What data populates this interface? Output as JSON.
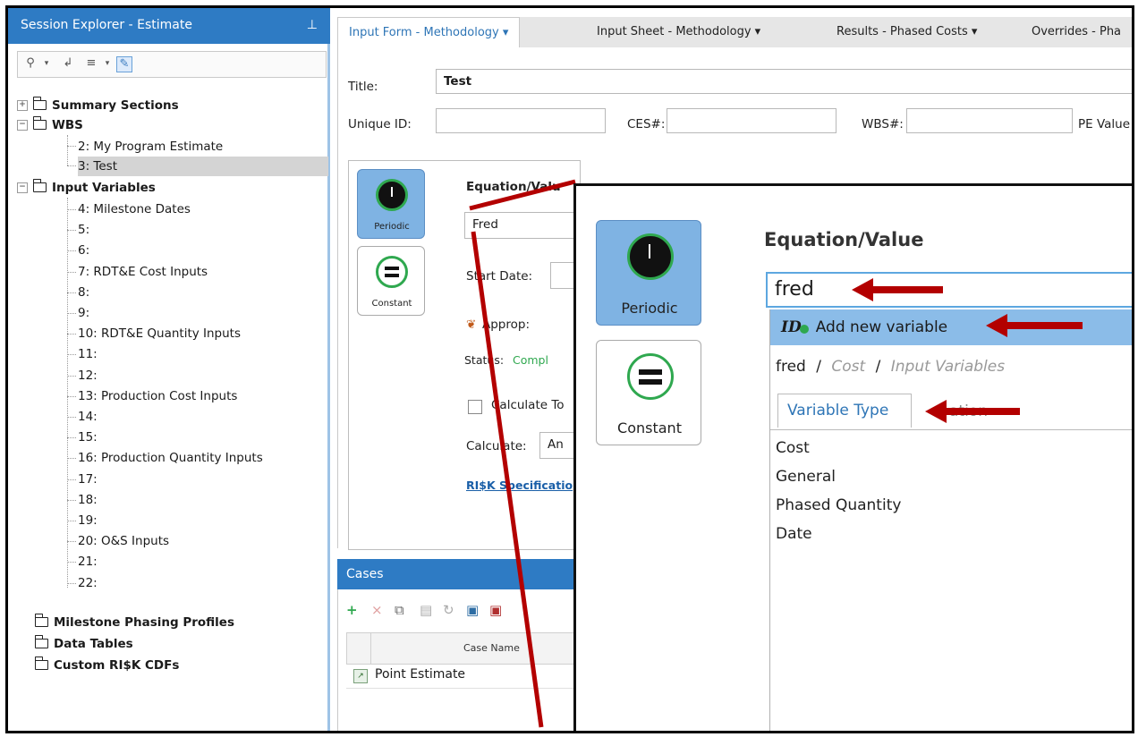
{
  "session_explorer": {
    "title": "Session Explorer - Estimate",
    "pin_icon": "pin-icon"
  },
  "tree": {
    "summary_sections": "Summary Sections",
    "wbs": "WBS",
    "wbs_children": [
      "2: My Program Estimate",
      "3: Test"
    ],
    "input_variables": "Input Variables",
    "input_children": [
      "4: Milestone Dates",
      "5:",
      "6:",
      "7: RDT&E Cost Inputs",
      "8:",
      "9:",
      "10: RDT&E Quantity Inputs",
      "11:",
      "12:",
      "13: Production Cost Inputs",
      "14:",
      "15:",
      "16: Production Quantity Inputs",
      "17:",
      "18:",
      "19:",
      "20: O&S Inputs",
      "21:",
      "22:"
    ],
    "milestone_profiles": "Milestone Phasing Profiles",
    "data_tables": "Data Tables",
    "custom_cdfs": "Custom RI$K CDFs"
  },
  "tabs": [
    "Input Form - Methodology ▾",
    "Input Sheet - Methodology ▾",
    "Results - Phased Costs ▾",
    "Overrides - Pha"
  ],
  "form": {
    "title_label": "Title:",
    "title_value": "Test",
    "unique_id_label": "Unique ID:",
    "ces_label": "CES#:",
    "wbs_label": "WBS#:",
    "pe_label": "PE Value"
  },
  "method": {
    "periodic": "Periodic",
    "constant": "Constant",
    "eq_label": "Equation/Valu",
    "eq_value": "Fred",
    "start_date": "Start Date:",
    "approp": "Approp:",
    "status_label": "Status:",
    "status_value": "Compl",
    "calc_total": "Calculate To",
    "calculate": "Calculate:",
    "calc_value": "An",
    "risk_link": "RI$K Specificatio"
  },
  "cases": {
    "title": "Cases",
    "col_case_name": "Case Name",
    "row1": "Point Estimate"
  },
  "zoom": {
    "periodic": "Periodic",
    "constant": "Constant",
    "eq_label": "Equation/Value",
    "input_value": "fred",
    "add_new": "Add new variable",
    "path_name": "fred",
    "path_sep": "/",
    "path_type": "Cost",
    "path_section": "Input Variables",
    "variable_type_tab": "Variable Type",
    "tab_behind": "ation",
    "types": [
      "Cost",
      "General",
      "Phased Quantity",
      "Date"
    ]
  },
  "colors": {
    "accent": "#2e7bc4",
    "highlight": "#8bbce8",
    "arrow": "#b30000",
    "status_green": "#2fa84f"
  }
}
